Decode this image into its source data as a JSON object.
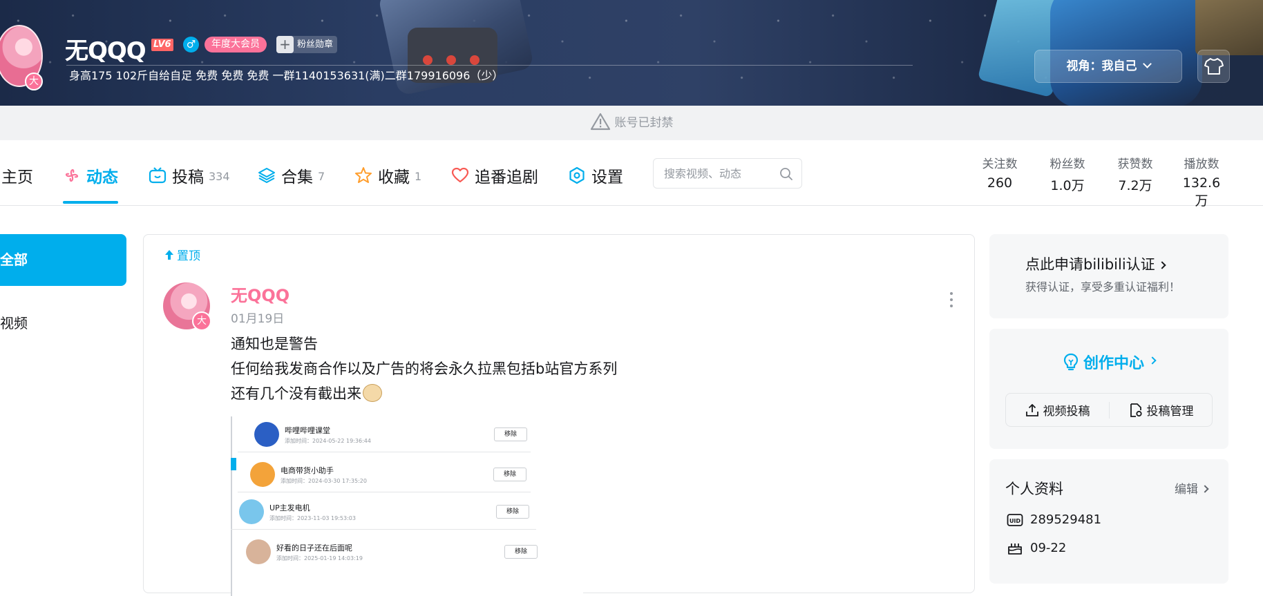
{
  "banner": {
    "name": "无QQQ",
    "level": "LV6",
    "gender": "♂",
    "vip_label": "年度大会员",
    "medal_label": "粉丝勋章",
    "medal_plus": "+",
    "avatar_badge": "大",
    "signature": "身高175 102斤自给自足 免费 免费 免费 一群1140153631(满)二群179916096（少）",
    "view_label": "视角：我自己"
  },
  "notice": {
    "text": "账号已封禁"
  },
  "nav": {
    "tabs": [
      {
        "label": "主页",
        "count": ""
      },
      {
        "label": "动态",
        "count": ""
      },
      {
        "label": "投稿",
        "count": "334"
      },
      {
        "label": "合集",
        "count": "7"
      },
      {
        "label": "收藏",
        "count": "1"
      },
      {
        "label": "追番追剧",
        "count": ""
      },
      {
        "label": "设置",
        "count": ""
      }
    ],
    "search_placeholder": "搜索视频、动态",
    "stats": [
      {
        "label": "关注数",
        "value": "260"
      },
      {
        "label": "粉丝数",
        "value": "1.0万"
      },
      {
        "label": "获赞数",
        "value": "7.2万"
      },
      {
        "label": "播放数",
        "value": "132.6万"
      }
    ]
  },
  "sidebar": {
    "items": [
      {
        "label": "全部"
      },
      {
        "label": "视频"
      }
    ]
  },
  "feed": {
    "pin_label": "置顶",
    "author": "无QQQ",
    "author_badge": "大",
    "date": "01月19日",
    "lines": [
      "通知也是警告",
      "任何给我发商合作以及广告的将会永久拉黑包括b站官方系列",
      "还有几个没有截出来"
    ],
    "image_rows": [
      {
        "name": "哔哩哔哩课堂",
        "time": "添加时间：2024-05-22 19:36:44",
        "button": "移除"
      },
      {
        "name": "电商带货小助手",
        "time": "添加时间：2024-03-30 17:35:20",
        "button": "移除"
      },
      {
        "name": "UP主发电机",
        "time": "添加时间：2023-11-03 19:53:03",
        "button": "移除"
      },
      {
        "name": "好看的日子还在后面呢",
        "time": "添加时间：2025-01-19 14:03:19",
        "button": "移除"
      }
    ]
  },
  "right": {
    "cert_title": "点此申请bilibili认证",
    "cert_sub": "获得认证，享受多重认证福利！",
    "creator_title": "创作中心",
    "creator_buttons": [
      {
        "label": "视频投稿"
      },
      {
        "label": "投稿管理"
      }
    ],
    "profile_title": "个人资料",
    "edit_label": "编辑",
    "uid": "289529481",
    "birthday": "09-22"
  },
  "colors": {
    "accent": "#00aeec",
    "pink": "#fb7299",
    "level_red": "#ff6666"
  }
}
